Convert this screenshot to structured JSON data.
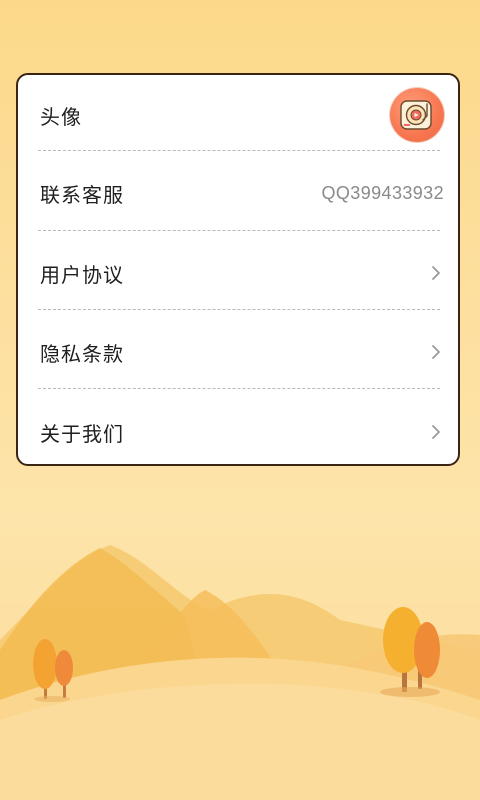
{
  "settings": {
    "items": [
      {
        "label": "头像",
        "type": "avatar",
        "icon": "record-player-avatar-icon"
      },
      {
        "label": "联系客服",
        "type": "value",
        "value": "QQ399433932"
      },
      {
        "label": "用户协议",
        "type": "link",
        "icon": "chevron-right-icon"
      },
      {
        "label": "隐私条款",
        "type": "link",
        "icon": "chevron-right-icon"
      },
      {
        "label": "关于我们",
        "type": "link",
        "icon": "chevron-right-icon"
      }
    ]
  },
  "theme": {
    "background_top": "#fcd98a",
    "background_bottom": "#fddb98",
    "card_border": "#3a2414",
    "avatar_color": "#f7764f",
    "accent": "#f1b93f"
  }
}
